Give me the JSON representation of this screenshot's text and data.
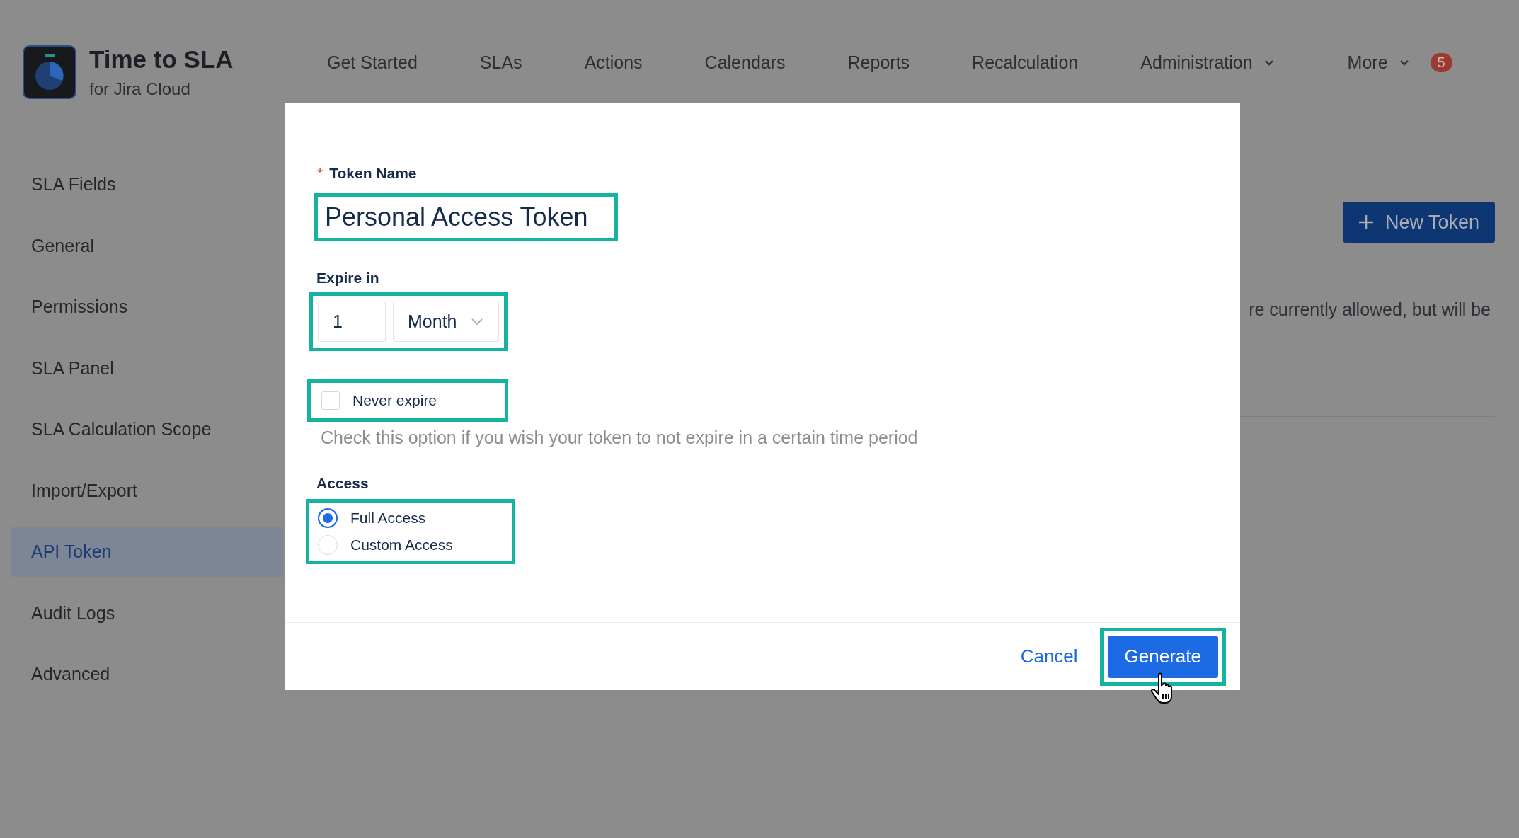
{
  "app": {
    "title": "Time to SLA",
    "subtitle": "for Jira Cloud"
  },
  "nav": [
    {
      "label": "Get Started",
      "dropdown": false
    },
    {
      "label": "SLAs",
      "dropdown": false
    },
    {
      "label": "Actions",
      "dropdown": false
    },
    {
      "label": "Calendars",
      "dropdown": false
    },
    {
      "label": "Reports",
      "dropdown": false
    },
    {
      "label": "Recalculation",
      "dropdown": false
    },
    {
      "label": "Administration",
      "dropdown": true
    },
    {
      "label": "More",
      "dropdown": true,
      "badge": "5"
    }
  ],
  "sidebar": {
    "items": [
      {
        "label": "SLA Fields",
        "selected": false
      },
      {
        "label": "General",
        "selected": false
      },
      {
        "label": "Permissions",
        "selected": false
      },
      {
        "label": "SLA Panel",
        "selected": false
      },
      {
        "label": "SLA Calculation Scope",
        "selected": false
      },
      {
        "label": "Import/Export",
        "selected": false
      },
      {
        "label": "API Token",
        "selected": true
      },
      {
        "label": "Audit Logs",
        "selected": false
      },
      {
        "label": "Advanced",
        "selected": false
      }
    ]
  },
  "page": {
    "new_token_button": "New Token",
    "notice_fragment": "re currently allowed, but will be"
  },
  "modal": {
    "token_name": {
      "label": "Token Name",
      "required_marker": "*",
      "value": "Personal Access Token",
      "highlighted": true
    },
    "expire": {
      "label": "Expire in",
      "amount": "1",
      "unit": "Month",
      "highlighted": true
    },
    "never_expire": {
      "label": "Never expire",
      "checked": false,
      "highlighted": true,
      "help": "Check this option if you wish your token to not expire in a certain time period"
    },
    "access": {
      "label": "Access",
      "highlighted": true,
      "options": [
        {
          "label": "Full Access",
          "selected": true
        },
        {
          "label": "Custom Access",
          "selected": false
        }
      ]
    },
    "buttons": [
      {
        "label": "Cancel",
        "kind": "link",
        "highlighted": false
      },
      {
        "label": "Generate",
        "kind": "primary",
        "highlighted": true
      }
    ]
  }
}
